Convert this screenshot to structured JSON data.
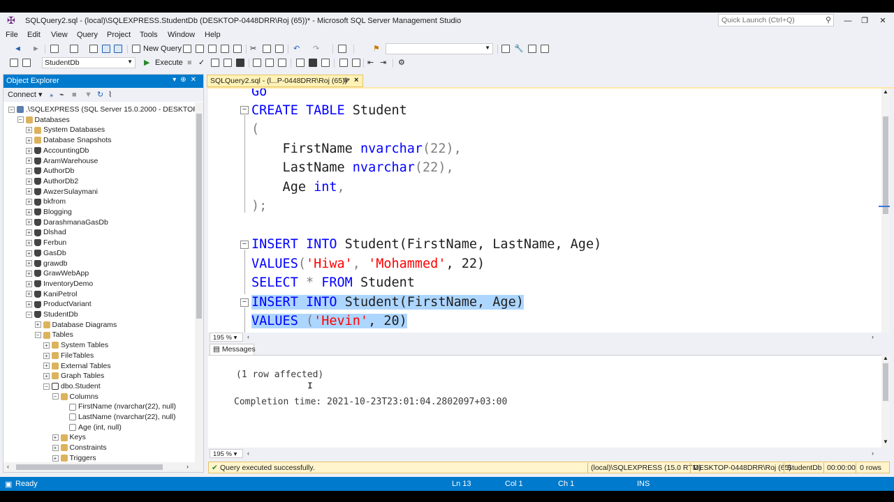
{
  "window": {
    "title": "SQLQuery2.sql - (local)\\SQLEXPRESS.StudentDb (DESKTOP-0448DRR\\Roj (65))* - Microsoft SQL Server Management Studio",
    "quick_launch_placeholder": "Quick Launch (Ctrl+Q)"
  },
  "menu": [
    "File",
    "Edit",
    "View",
    "Query",
    "Project",
    "Tools",
    "Window",
    "Help"
  ],
  "toolbar1": {
    "new_query": "New Query"
  },
  "toolbar2": {
    "database": "StudentDb",
    "execute": "Execute"
  },
  "object_explorer": {
    "title": "Object Explorer",
    "connect": "Connect",
    "tree": [
      {
        "label": ".\\SQLEXPRESS (SQL Server 15.0.2000 - DESKTOP-0448D",
        "icon": "server-icon",
        "expander": "−"
      },
      {
        "label": "Databases",
        "icon": "folder-icon",
        "expander": "−"
      },
      {
        "label": "System Databases",
        "icon": "folder-icon",
        "expander": "+"
      },
      {
        "label": "Database Snapshots",
        "icon": "folder-icon",
        "expander": "+"
      },
      {
        "label": "AccountingDb",
        "icon": "database-icon",
        "expander": "+"
      },
      {
        "label": "AramWarehouse",
        "icon": "database-icon",
        "expander": "+"
      },
      {
        "label": "AuthorDb",
        "icon": "database-icon",
        "expander": "+"
      },
      {
        "label": "AuthorDb2",
        "icon": "database-icon",
        "expander": "+"
      },
      {
        "label": "AwzerSulaymani",
        "icon": "database-icon",
        "expander": "+"
      },
      {
        "label": "bkfrom",
        "icon": "database-icon",
        "expander": "+"
      },
      {
        "label": "Blogging",
        "icon": "database-icon",
        "expander": "+"
      },
      {
        "label": "DarashmanaGasDb",
        "icon": "database-icon",
        "expander": "+"
      },
      {
        "label": "Dlshad",
        "icon": "database-icon",
        "expander": "+"
      },
      {
        "label": "Ferbun",
        "icon": "database-icon",
        "expander": "+"
      },
      {
        "label": "GasDb",
        "icon": "database-icon",
        "expander": "+"
      },
      {
        "label": "grawdb",
        "icon": "database-icon",
        "expander": "+"
      },
      {
        "label": "GrawWebApp",
        "icon": "database-icon",
        "expander": "+"
      },
      {
        "label": "InventoryDemo",
        "icon": "database-icon",
        "expander": "+"
      },
      {
        "label": "KaniPetrol",
        "icon": "database-icon",
        "expander": "+"
      },
      {
        "label": "ProductVariant",
        "icon": "database-icon",
        "expander": "+"
      },
      {
        "label": "StudentDb",
        "icon": "database-icon",
        "expander": "−"
      },
      {
        "label": "Database Diagrams",
        "icon": "folder-icon",
        "expander": "+"
      },
      {
        "label": "Tables",
        "icon": "folder-icon",
        "expander": "−"
      },
      {
        "label": "System Tables",
        "icon": "folder-icon",
        "expander": "+"
      },
      {
        "label": "FileTables",
        "icon": "folder-icon",
        "expander": "+"
      },
      {
        "label": "External Tables",
        "icon": "folder-icon",
        "expander": "+"
      },
      {
        "label": "Graph Tables",
        "icon": "folder-icon",
        "expander": "+"
      },
      {
        "label": "dbo.Student",
        "icon": "table-icon",
        "expander": "−"
      },
      {
        "label": "Columns",
        "icon": "folder-icon",
        "expander": "−"
      },
      {
        "label": "FirstName (nvarchar(22), null)",
        "icon": "column-icon",
        "expander": ""
      },
      {
        "label": "LastName (nvarchar(22), null)",
        "icon": "column-icon",
        "expander": ""
      },
      {
        "label": "Age (int, null)",
        "icon": "column-icon",
        "expander": ""
      },
      {
        "label": "Keys",
        "icon": "folder-icon",
        "expander": "+"
      },
      {
        "label": "Constraints",
        "icon": "folder-icon",
        "expander": "+"
      },
      {
        "label": "Triggers",
        "icon": "folder-icon",
        "expander": "+"
      }
    ]
  },
  "document_tab": {
    "label": "SQLQuery2.sql - (l...P-0448DRR\\Roj (65))*",
    "pin": "⊕",
    "close": "×"
  },
  "editor": {
    "lines": {
      "go": "Go",
      "create_kw": "CREATE TABLE",
      "create_name": " Student",
      "open_paren": "(",
      "col1_name": "    FirstName ",
      "col1_type": "nvarchar",
      "col1_rest": "(22),",
      "col2_name": "    LastName ",
      "col2_type": "nvarchar",
      "col2_rest": "(22),",
      "col3_name": "    Age ",
      "col3_type": "int",
      "col3_rest": ",",
      "close": ");",
      "ins1_kw": "INSERT INTO",
      "ins1_rest": " Student(FirstName, LastName, Age)",
      "val1_kw": "VALUES",
      "val1_open": "(",
      "val1_s1": "'Hiwa'",
      "val1_comma": ", ",
      "val1_s2": "'Mohammed'",
      "val1_rest": ", 22)",
      "sel_kw1": "SELECT",
      "sel_star": " * ",
      "sel_kw2": "FROM",
      "sel_rest": " Student",
      "ins2_kw": "INSERT INTO",
      "ins2_rest": " Student(FirstName, Age)",
      "val2_kw": "VALUES",
      "val2_open": " (",
      "val2_s1": "'Hevin'",
      "val2_rest": ", 20)"
    },
    "zoom": "195 %"
  },
  "results": {
    "tab": "Messages",
    "line1": "(1 row affected)",
    "line2": "Completion time: 2021-10-23T23:01:04.2802097+03:00",
    "zoom": "195 %"
  },
  "query_status": {
    "message": "Query executed successfully.",
    "server": "(local)\\SQLEXPRESS (15.0 RTM)",
    "user": "DESKTOP-0448DRR\\Roj (65)",
    "database": "StudentDb",
    "elapsed": "00:00:00",
    "rows": "0 rows"
  },
  "statusbar": {
    "ready": "Ready",
    "ln": "Ln 13",
    "col": "Col 1",
    "ch": "Ch 1",
    "mode": "INS"
  },
  "colors": {
    "accent": "#007acc",
    "keyword": "#0000ff",
    "string": "#ff0000",
    "selection": "#add6ff",
    "query_bar": "#fff4cc"
  }
}
